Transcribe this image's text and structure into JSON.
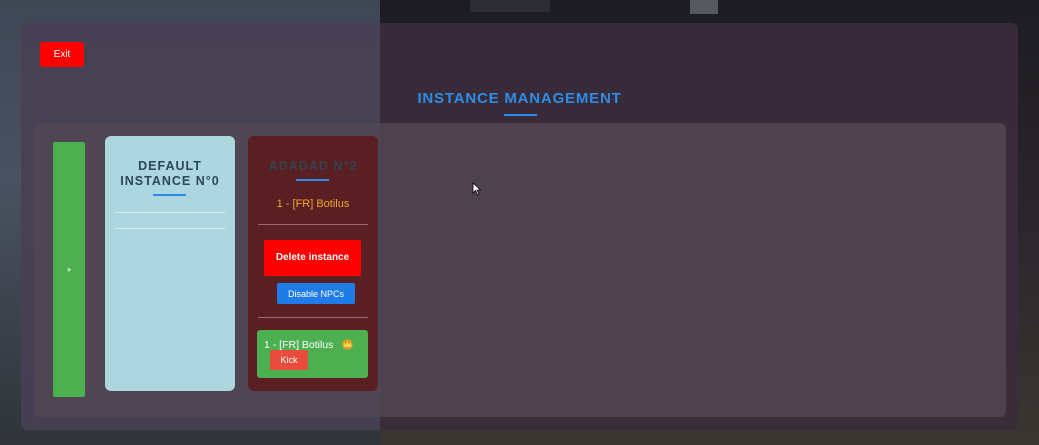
{
  "header": {
    "exit_label": "Exit",
    "title": "INSTANCE MANAGEMENT"
  },
  "add_button": {
    "label": "+"
  },
  "instances": [
    {
      "title": "DEFAULT INSTANCE N°0"
    },
    {
      "title": "ADADAD N°2",
      "player_summary": "1 - [FR] Botilus",
      "delete_label": "Delete instance",
      "npc_label": "Disable NPCs",
      "players": [
        {
          "name": "1 - [FR] Botilus",
          "kick_label": "Kick",
          "icon": "crown-icon"
        }
      ]
    }
  ],
  "colors": {
    "accent": "#2f8ce6",
    "danger": "#ff0000",
    "success": "#4caf50",
    "warning_text": "#f0a830"
  }
}
